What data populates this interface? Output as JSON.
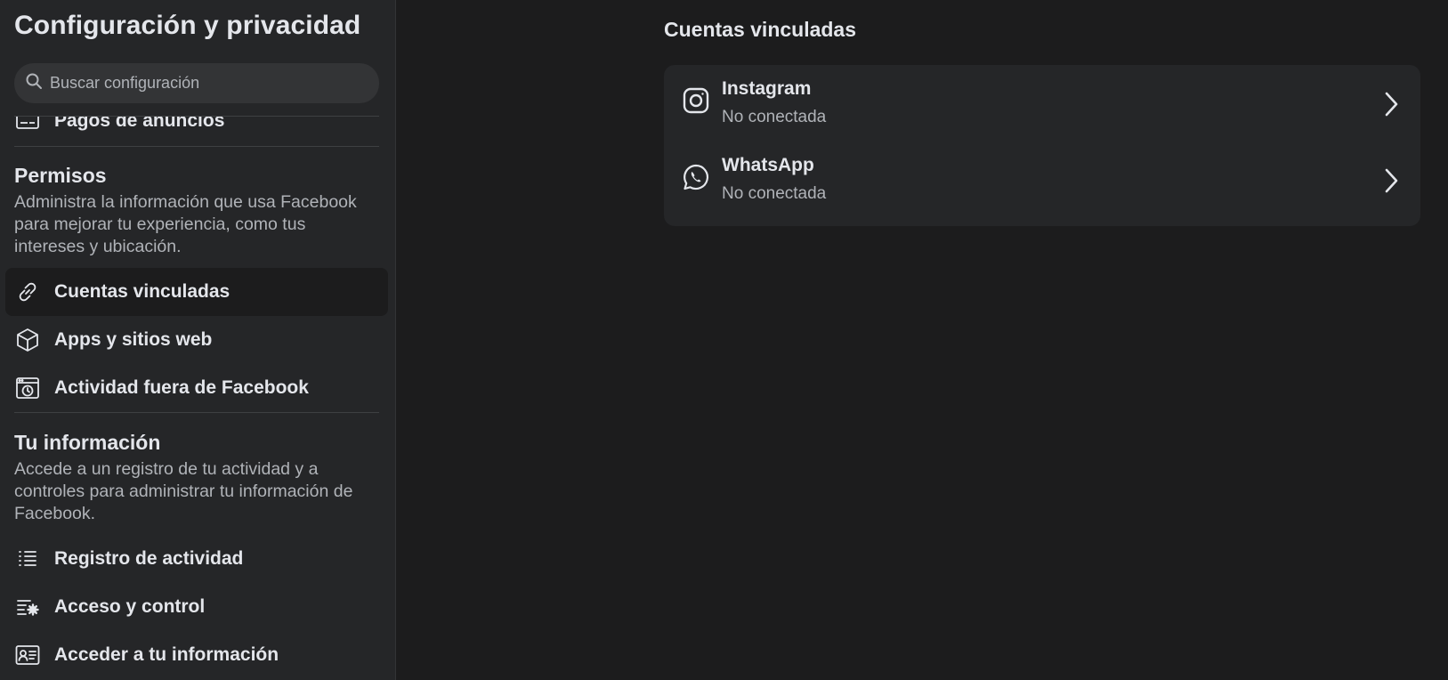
{
  "sidebar": {
    "title": "Configuración y privacidad",
    "search": {
      "placeholder": "Buscar configuración"
    },
    "partial_item": {
      "label": "Pagos de anuncios",
      "icon": "credit-card-icon"
    },
    "permissions": {
      "title": "Permisos",
      "description": "Administra la información que usa Facebook para mejorar tu experiencia, como tus intereses y ubicación.",
      "items": [
        {
          "label": "Cuentas vinculadas",
          "icon": "link-icon",
          "active": true
        },
        {
          "label": "Apps y sitios web",
          "icon": "cube-icon",
          "active": false
        },
        {
          "label": "Actividad fuera de Facebook",
          "icon": "browser-history-icon",
          "active": false
        }
      ]
    },
    "your_info": {
      "title": "Tu información",
      "description": "Accede a un registro de tu actividad y a controles para administrar tu información de Facebook.",
      "items": [
        {
          "label": "Registro de actividad",
          "icon": "list-icon"
        },
        {
          "label": "Acceso y control",
          "icon": "list-settings-icon"
        },
        {
          "label": "Acceder a tu información",
          "icon": "id-card-icon"
        }
      ]
    }
  },
  "main": {
    "title": "Cuentas vinculadas",
    "accounts": [
      {
        "name": "Instagram",
        "status": "No conectada",
        "icon": "instagram-icon"
      },
      {
        "name": "WhatsApp",
        "status": "No conectada",
        "icon": "whatsapp-icon"
      }
    ]
  },
  "colors": {
    "page_bg": "#1c1c1d",
    "panel_bg": "#252628",
    "text_primary": "#e4e6eb",
    "text_secondary": "#b0b3b8"
  }
}
